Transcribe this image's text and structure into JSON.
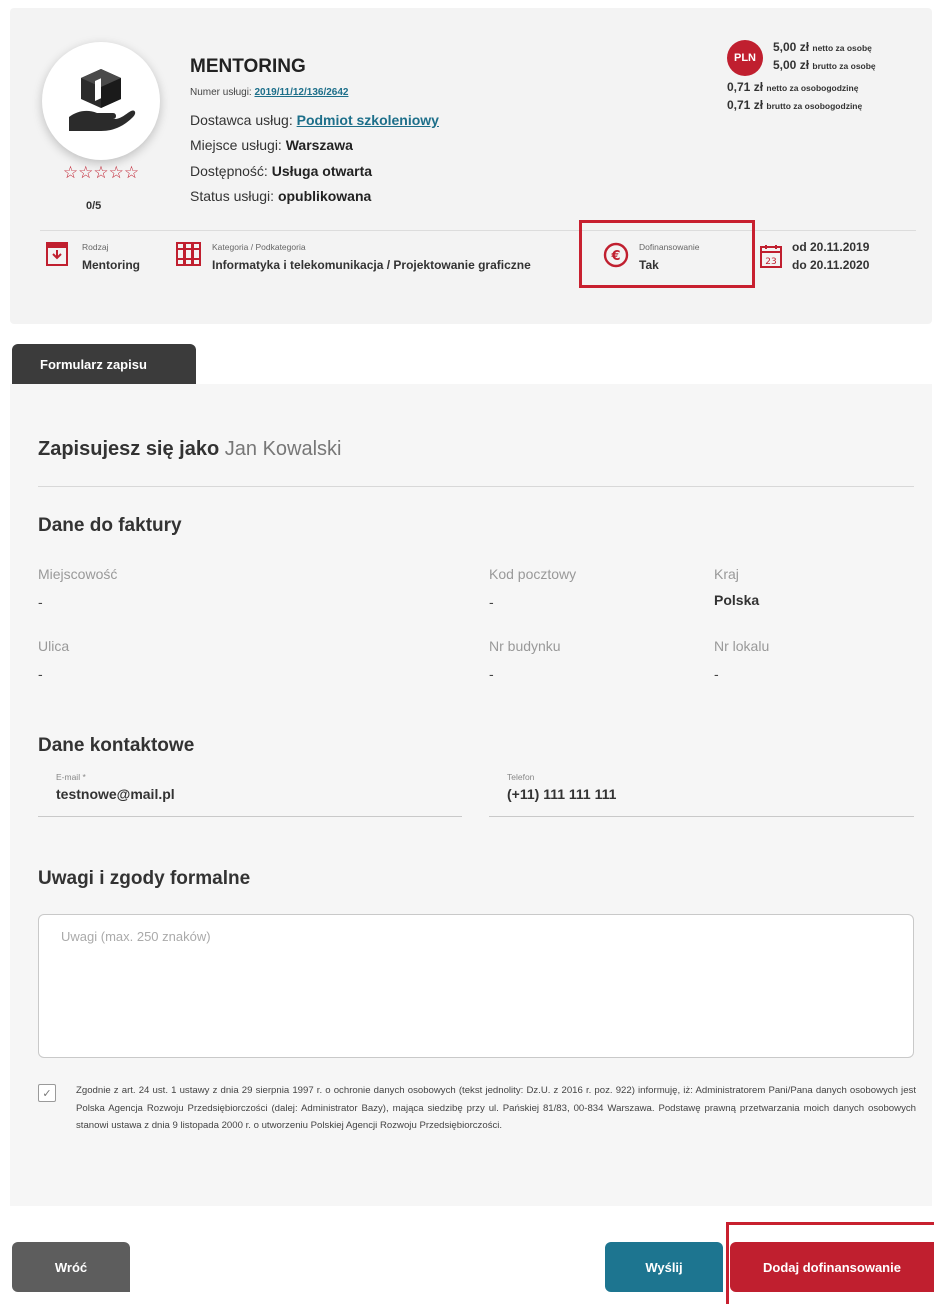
{
  "service": {
    "title": "MENTORING",
    "number_label": "Numer usługi:",
    "number_value": "2019/11/12/136/2642",
    "provider_label": "Dostawca usług:",
    "provider_value": "Podmiot szkoleniowy",
    "place_label": "Miejsce usługi:",
    "place_value": "Warszawa",
    "availability_label": "Dostępność:",
    "availability_value": "Usługa otwarta",
    "status_label": "Status usługi:",
    "status_value": "opublikowana",
    "stars": "☆☆☆☆☆",
    "rating": "0/5",
    "logo_icon": "hand-holding-box-icon"
  },
  "price": {
    "currency_badge": "PLN",
    "rows": [
      {
        "amount": "5,00 zł",
        "suffix": "netto za osobę"
      },
      {
        "amount": "5,00 zł",
        "suffix": "brutto za osobę"
      },
      {
        "amount": "0,71 zł",
        "suffix": "netto za osobogodzinę"
      },
      {
        "amount": "0,71 zł",
        "suffix": "brutto za osobogodzinę"
      }
    ]
  },
  "meta": {
    "type_label": "Rodzaj",
    "type_value": "Mentoring",
    "category_label": "Kategoria / Podkategoria",
    "category_value": "Informatyka i telekomunikacja / Projektowanie graficzne",
    "funding_label": "Dofinansowanie",
    "funding_value": "Tak",
    "date_from": "od 20.11.2019",
    "date_to": "do 20.11.2020",
    "calendar_day": "23"
  },
  "tab": {
    "label": "Formularz zapisu"
  },
  "form": {
    "signed_as_label": "Zapisujesz się jako",
    "signed_as_name": "Jan Kowalski",
    "invoice_heading": "Dane do faktury",
    "city_label": "Miejscowość",
    "city_value": "-",
    "postal_label": "Kod pocztowy",
    "postal_value": "-",
    "country_label": "Kraj",
    "country_value": "Polska",
    "street_label": "Ulica",
    "street_value": "-",
    "building_label": "Nr budynku",
    "building_value": "-",
    "unit_label": "Nr lokalu",
    "unit_value": "-",
    "contact_heading": "Dane kontaktowe",
    "email_label": "E-mail *",
    "email_value": "testnowe@mail.pl",
    "phone_label": "Telefon",
    "phone_value": "(+11) 111 111 111",
    "remarks_heading": "Uwagi i zgody formalne",
    "remarks_placeholder": "Uwagi (max. 250 znaków)",
    "consent_checked": true,
    "consent_mark": "✓",
    "consent_text": "Zgodnie z art. 24 ust. 1 ustawy z dnia 29 sierpnia 1997 r. o ochronie danych osobowych (tekst jednolity: Dz.U. z 2016 r. poz. 922) informuję, iż: Administratorem Pani/Pana danych osobowych jest Polska Agencja Rozwoju Przedsiębiorczości (dalej: Administrator Bazy), mająca siedzibę przy ul. Pańskiej 81/83, 00-834 Warszawa. Podstawę prawną przetwarzania moich danych osobowych stanowi ustawa z dnia 9 listopada 2000 r. o utworzeniu Polskiej Agencji Rozwoju Przedsiębiorczości."
  },
  "buttons": {
    "back": "Wróć",
    "send": "Wyślij",
    "add_funding": "Dodaj dofinansowanie"
  },
  "colors": {
    "accent_red": "#c01f2f",
    "highlight_red": "#c8202f",
    "send_teal": "#1d7590",
    "back_gray": "#5d5d5d",
    "tab_dark": "#3b3b3b"
  }
}
